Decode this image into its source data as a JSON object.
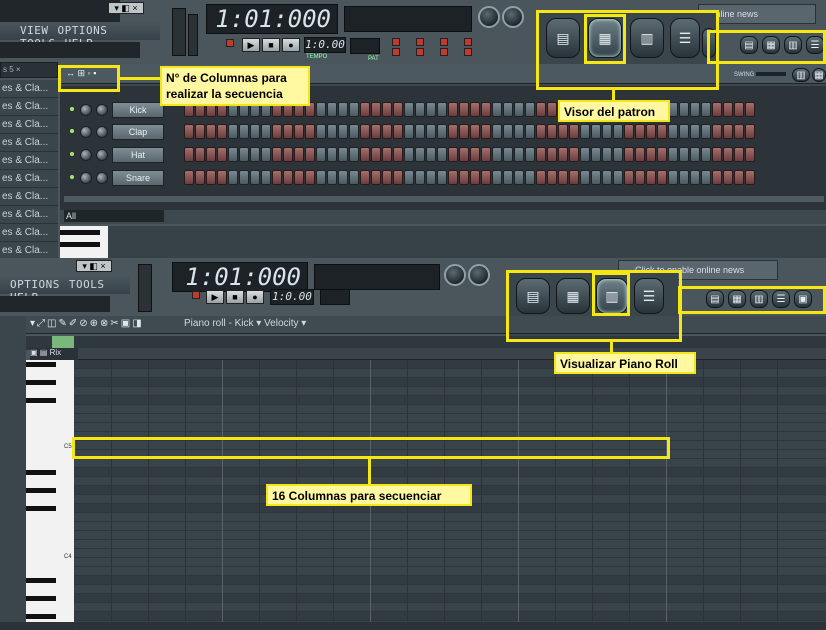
{
  "menu_top": [
    "VIEW",
    "OPTIONS",
    "TOOLS",
    "HELP"
  ],
  "menu_bottom": [
    "OPTIONS",
    "TOOLS",
    "HELP"
  ],
  "time_display": "1:01:000",
  "news_prompt": "Click to enable online news",
  "news_prompt_partial": "e online news",
  "pattern_label": "PAT",
  "tempo_label": "TEMPO",
  "swing_label": "SWING",
  "browser_items": [
    "es & Cla...",
    "es & Cla...",
    "es & Cla...",
    "es & Cla...",
    "es & Cla...",
    "es & Cla...",
    "es & Cla...",
    "es & Cla...",
    "es & Cla...",
    "es & Cla..."
  ],
  "channel_filter": "All",
  "channels": [
    {
      "name": "Kick"
    },
    {
      "name": "Clap"
    },
    {
      "name": "Hat"
    },
    {
      "name": "Snare"
    }
  ],
  "piano_roll_title": "Piano roll - Kick",
  "piano_roll_param": "Velocity",
  "key_label_c5": "C5",
  "key_label_c4": "C4",
  "annotations": {
    "columns": "N° de Columnas para realizar la secuencia",
    "columns_line1": "N° de Columnas para",
    "columns_line2": "realizar la secuencia",
    "pattern_viewer": "Visor del patron",
    "piano_roll": "Visualizar Piano Roll",
    "sixteen": "16 Columnas para secuenciar"
  },
  "colors": {
    "highlight": "#f5e716",
    "step_active": "#8a4f4d",
    "step_inactive": "#657279",
    "panel": "#3b464d"
  }
}
